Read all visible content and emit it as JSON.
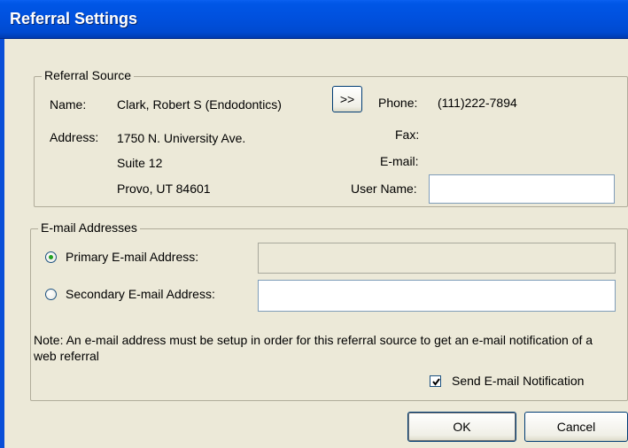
{
  "window": {
    "title": "Referral Settings"
  },
  "referral_source": {
    "legend": "Referral Source",
    "name_label": "Name:",
    "name_value": "Clark, Robert S (Endodontics)",
    "details_button": ">>",
    "phone_label": "Phone:",
    "phone_value": "(111)222-7894",
    "address_label": "Address:",
    "address_line1": "1750 N. University Ave.",
    "address_line2": "Suite 12",
    "address_line3": "Provo, UT 84601",
    "fax_label": "Fax:",
    "email_label": "E-mail:",
    "username_label": "User Name:",
    "username_value": ""
  },
  "email_addresses": {
    "legend": "E-mail Addresses",
    "primary_label": "Primary E-mail Address:",
    "primary_selected": true,
    "primary_value": "",
    "secondary_label": "Secondary E-mail Address:",
    "secondary_value": "",
    "note": "Note: An e-mail address must be setup in order for this referral source to get an e-mail notification of a web referral",
    "send_notification_label": "Send E-mail Notification",
    "send_notification_checked": true
  },
  "buttons": {
    "ok": "OK",
    "cancel": "Cancel"
  }
}
